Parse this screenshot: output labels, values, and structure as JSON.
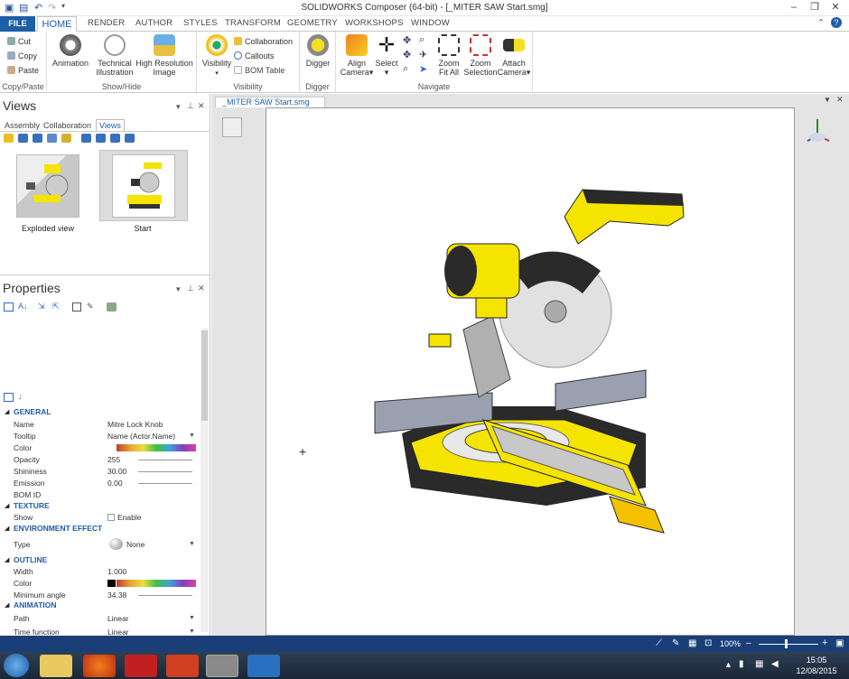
{
  "app": {
    "title": "SOLIDWORKS Composer (64-bit) - [_MITER SAW Start.smg]"
  },
  "tabs": [
    "FILE",
    "HOME",
    "RENDER",
    "AUTHOR",
    "STYLES",
    "TRANSFORM",
    "GEOMETRY",
    "WORKSHOPS",
    "WINDOW"
  ],
  "ribbon": {
    "clipboard": {
      "cut": "Cut",
      "copy": "Copy",
      "paste": "Paste",
      "label": "Copy/Paste"
    },
    "showhide": {
      "animation": "Animation",
      "technical": "Technical",
      "illustration": "Illustration",
      "highres": "High Resolution",
      "image": "Image",
      "label": "Show/Hide"
    },
    "visibility": {
      "visibility": "Visibility",
      "collaboration": "Collaboration",
      "callouts": "Callouts",
      "bom": "BOM Table",
      "label": "Visibility"
    },
    "digger": {
      "digger": "Digger",
      "label": "Digger"
    },
    "navigate": {
      "align1": "Align",
      "align2": "Camera",
      "select": "Select",
      "zoom1": "Zoom",
      "zoom2": "Fit All",
      "zoomsel1": "Zoom",
      "zoomsel2": "Selection",
      "attach1": "Attach",
      "attach2": "Camera",
      "label": "Navigate"
    }
  },
  "views": {
    "title": "Views",
    "subtabs": [
      "Assembly",
      "Collaboration",
      "Views"
    ],
    "items": [
      {
        "label": "Exploded view"
      },
      {
        "label": "Start"
      }
    ]
  },
  "properties": {
    "title": "Properties",
    "sections": {
      "general": "GENERAL",
      "texture": "TEXTURE",
      "env": "ENVIRONMENT EFFECT",
      "outline": "OUTLINE",
      "animation": "ANIMATION"
    },
    "rows": {
      "name": {
        "label": "Name",
        "value": "Mitre Lock Knob"
      },
      "tooltip": {
        "label": "Tooltip",
        "value": "Name (Actor.Name)"
      },
      "color": {
        "label": "Color"
      },
      "opacity": {
        "label": "Opacity",
        "value": "255"
      },
      "shininess": {
        "label": "Shininess",
        "value": "30.00"
      },
      "emission": {
        "label": "Emission",
        "value": "0.00"
      },
      "bomid": {
        "label": "BOM ID"
      },
      "show": {
        "label": "Show",
        "value": "Enable"
      },
      "type": {
        "label": "Type",
        "value": "None"
      },
      "width": {
        "label": "Width",
        "value": "1.000"
      },
      "ocolor": {
        "label": "Color"
      },
      "minangle": {
        "label": "Minimum angle",
        "value": "34.38"
      },
      "path": {
        "label": "Path",
        "value": "Linear"
      },
      "timefn": {
        "label": "Time function",
        "value": "Linear"
      }
    }
  },
  "document": {
    "tab": "_MITER SAW Start.smg"
  },
  "status": {
    "zoom": "100%"
  },
  "clock": {
    "time": "15:05",
    "date": "12/08/2015"
  },
  "colors": {
    "accent": "#1d5ea8",
    "statusbar": "#1a3f78",
    "saw_yellow": "#f5e400"
  }
}
